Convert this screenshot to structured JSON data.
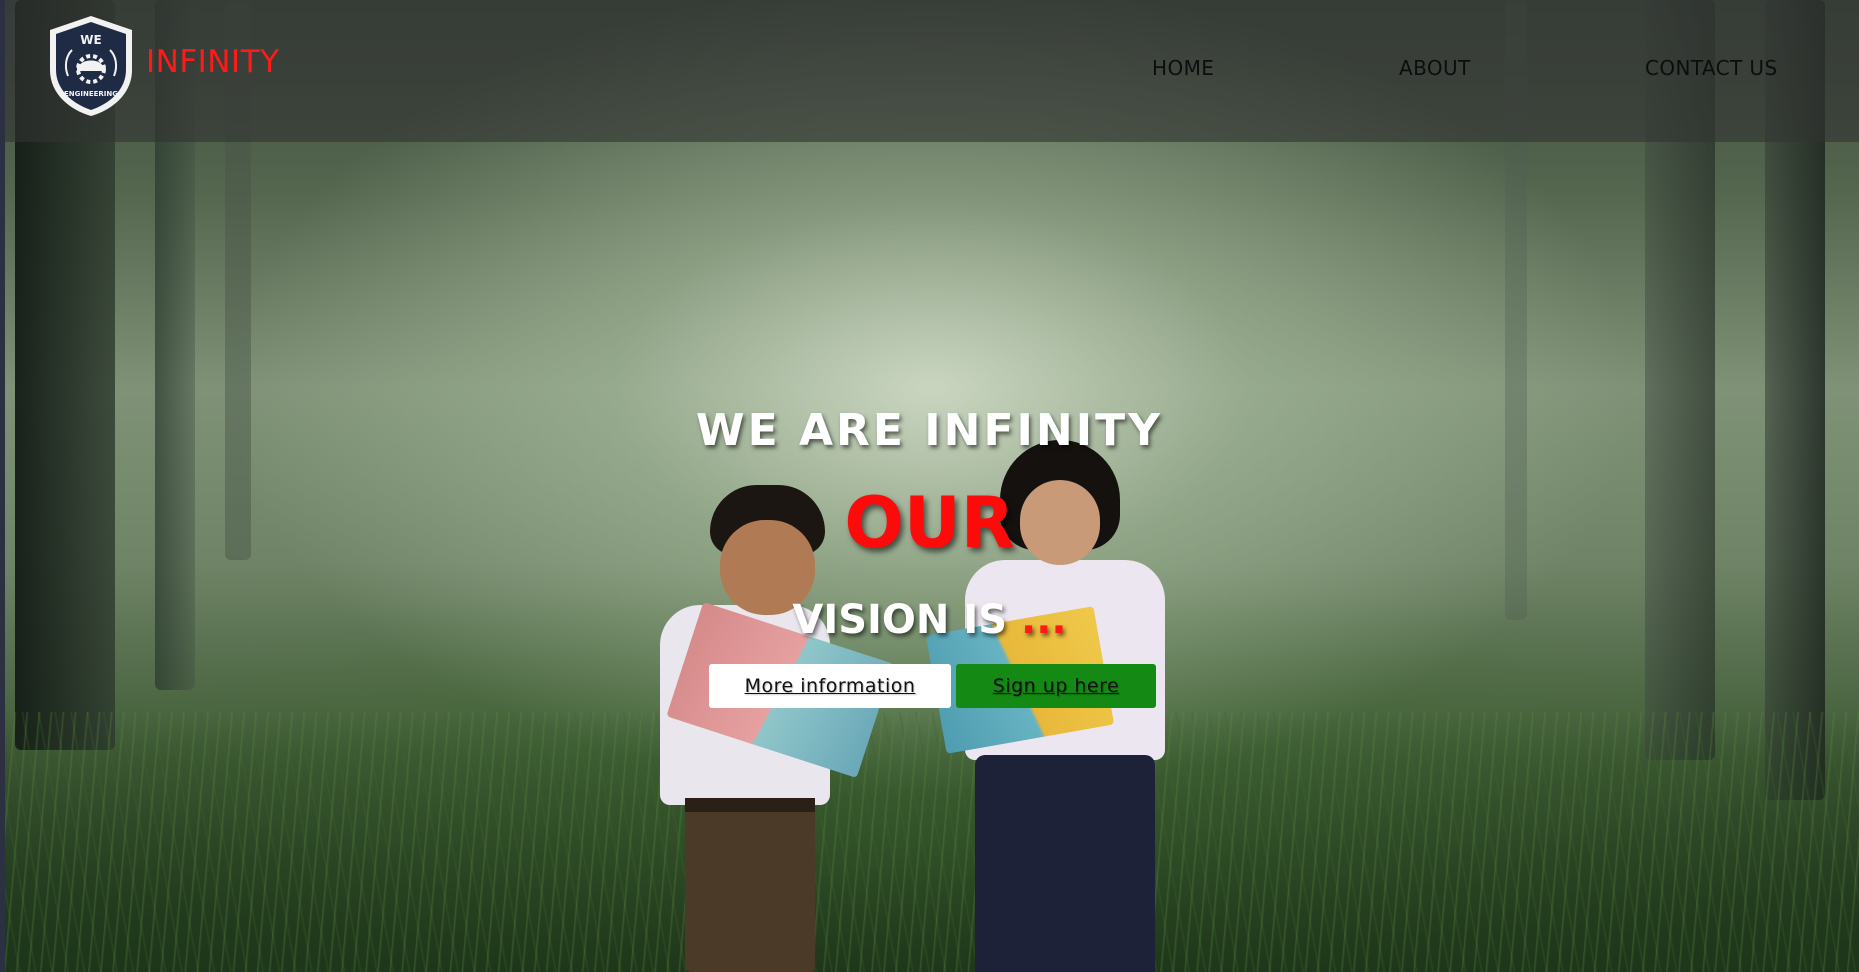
{
  "brand": {
    "name": "INFINITY",
    "logo_top_text": "WE",
    "logo_bottom_text": "ENGINEERING",
    "name_color": "#ff1a1a"
  },
  "nav": {
    "items": [
      {
        "label": "HOME"
      },
      {
        "label": "ABOUT"
      },
      {
        "label": "CONTACT US"
      }
    ]
  },
  "hero": {
    "title": "WE ARE INFINITY",
    "highlight": "OUR",
    "subtitle": "VISION IS",
    "dots": "...",
    "highlight_color": "#ff0a0a",
    "buttons": {
      "more_info": "More information",
      "sign_up": "Sign up here"
    },
    "sign_up_color": "#148a14"
  },
  "icons": {
    "logo": "shield-helmet-gear-logo"
  }
}
